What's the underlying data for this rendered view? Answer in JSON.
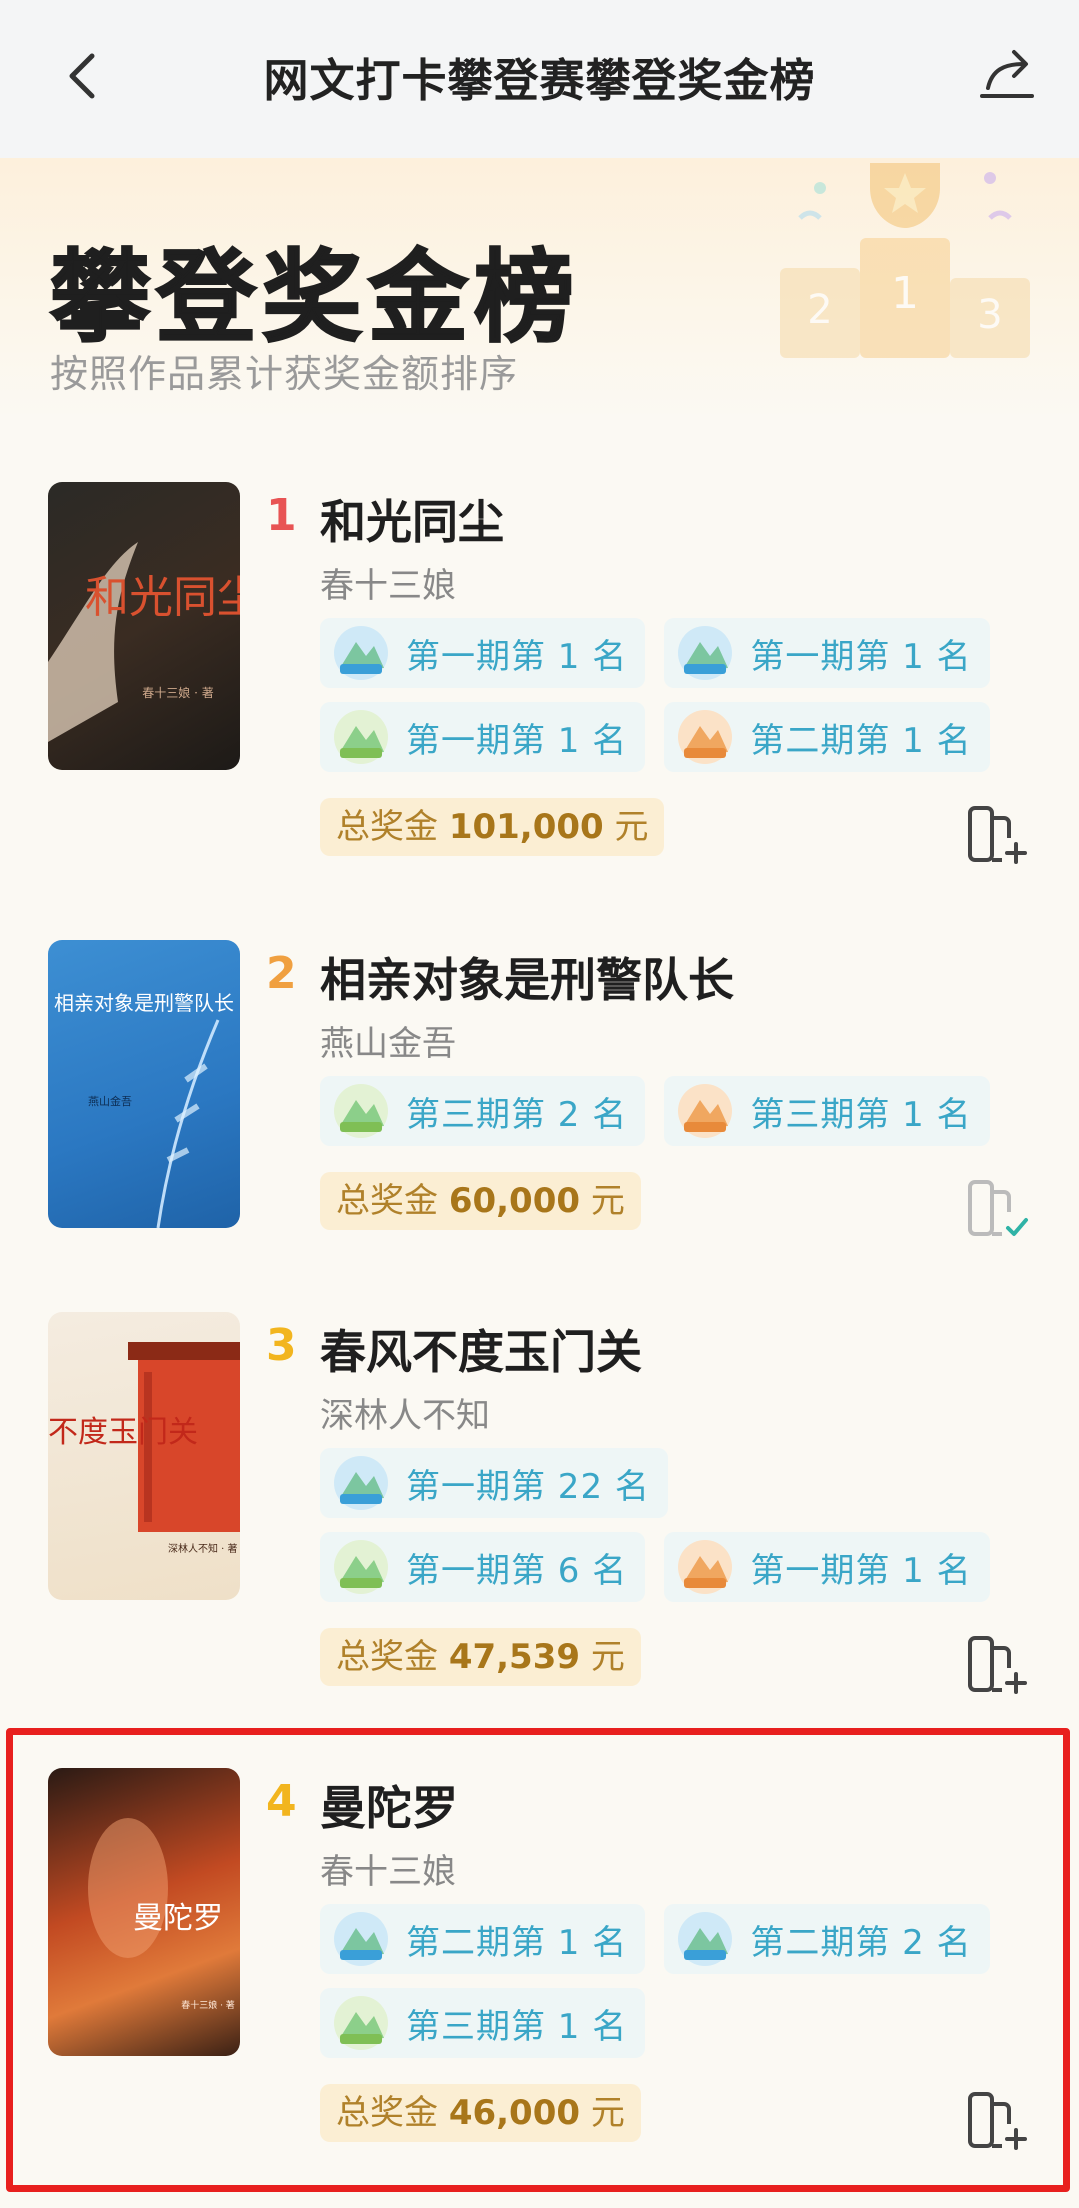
{
  "header": {
    "title": "网文打卡攀登赛攀登奖金榜"
  },
  "hero": {
    "title": "攀登奖金榜",
    "subtitle": "按照作品累计获奖金额排序"
  },
  "colors": {
    "rank1": "#e85454",
    "rank2": "#f0a040",
    "rank3": "#f2b51e",
    "rank4": "#f2b51e",
    "tag_text": "#3aa6c7",
    "prize_text": "#b0812a",
    "highlight": "#e8201e"
  },
  "books": [
    {
      "rank": "1",
      "title": "和光同尘",
      "author": "春十三娘",
      "cover_text": "和光同尘",
      "cover_author": "春十三娘 · 著",
      "tags": [
        "第一期第 1 名",
        "第一期第 1 名",
        "第一期第 1 名",
        "第二期第 1 名"
      ],
      "prize_label": "总奖金",
      "prize_amount": "101,000",
      "prize_unit": "元",
      "shelf": "add"
    },
    {
      "rank": "2",
      "title": "相亲对象是刑警队长",
      "author": "燕山金吾",
      "cover_text": "相亲对象是刑警队长",
      "cover_author": "燕山金吾",
      "tags": [
        "第三期第 2 名",
        "第三期第 1 名"
      ],
      "prize_label": "总奖金",
      "prize_amount": "60,000",
      "prize_unit": "元",
      "shelf": "added"
    },
    {
      "rank": "3",
      "title": "春风不度玉门关",
      "author": "深林人不知",
      "cover_text": "春风不度玉门关",
      "cover_author": "深林人不知 · 著",
      "tags": [
        "第一期第 22 名",
        "第一期第 6 名",
        "第一期第 1 名"
      ],
      "prize_label": "总奖金",
      "prize_amount": "47,539",
      "prize_unit": "元",
      "shelf": "add"
    },
    {
      "rank": "4",
      "title": "曼陀罗",
      "author": "春十三娘",
      "cover_text": "曼陀罗",
      "cover_author": "春十三娘 · 著",
      "tags": [
        "第二期第 1 名",
        "第二期第 2 名",
        "第三期第 1 名"
      ],
      "prize_label": "总奖金",
      "prize_amount": "46,000",
      "prize_unit": "元",
      "shelf": "add"
    }
  ]
}
